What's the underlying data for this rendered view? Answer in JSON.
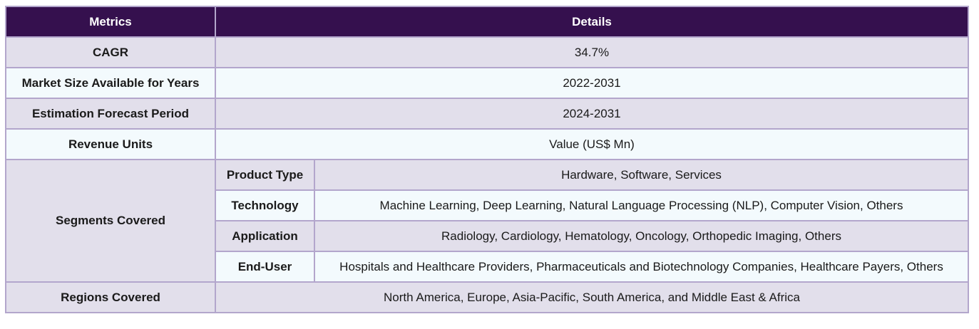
{
  "header": {
    "col1": "Metrics",
    "col2": "Details"
  },
  "rows": {
    "cagr": {
      "label": "CAGR",
      "value": "34.7%"
    },
    "market_size": {
      "label": "Market Size Available for Years",
      "value": "2022-2031"
    },
    "forecast": {
      "label": "Estimation Forecast Period",
      "value": "2024-2031"
    },
    "revenue_units": {
      "label": "Revenue Units",
      "value": "Value (US$ Mn)"
    },
    "segments": {
      "label": "Segments Covered",
      "items": [
        {
          "label": "Product Type",
          "value": "Hardware, Software, Services"
        },
        {
          "label": "Technology",
          "value": "Machine Learning, Deep Learning, Natural Language Processing (NLP), Computer Vision, Others"
        },
        {
          "label": "Application",
          "value": "Radiology, Cardiology, Hematology, Oncology, Orthopedic Imaging, Others"
        },
        {
          "label": "End-User",
          "value": "Hospitals and Healthcare Providers, Pharmaceuticals and Biotechnology Companies, Healthcare Payers, Others"
        }
      ]
    },
    "regions": {
      "label": "Regions Covered",
      "value": "North America, Europe, Asia-Pacific, South America, and Middle East & Africa"
    }
  },
  "colors": {
    "header_bg": "#35104e",
    "row_shade": "#e2dfeb",
    "row_light": "#f3fafd",
    "border": "#b3a6cc"
  }
}
